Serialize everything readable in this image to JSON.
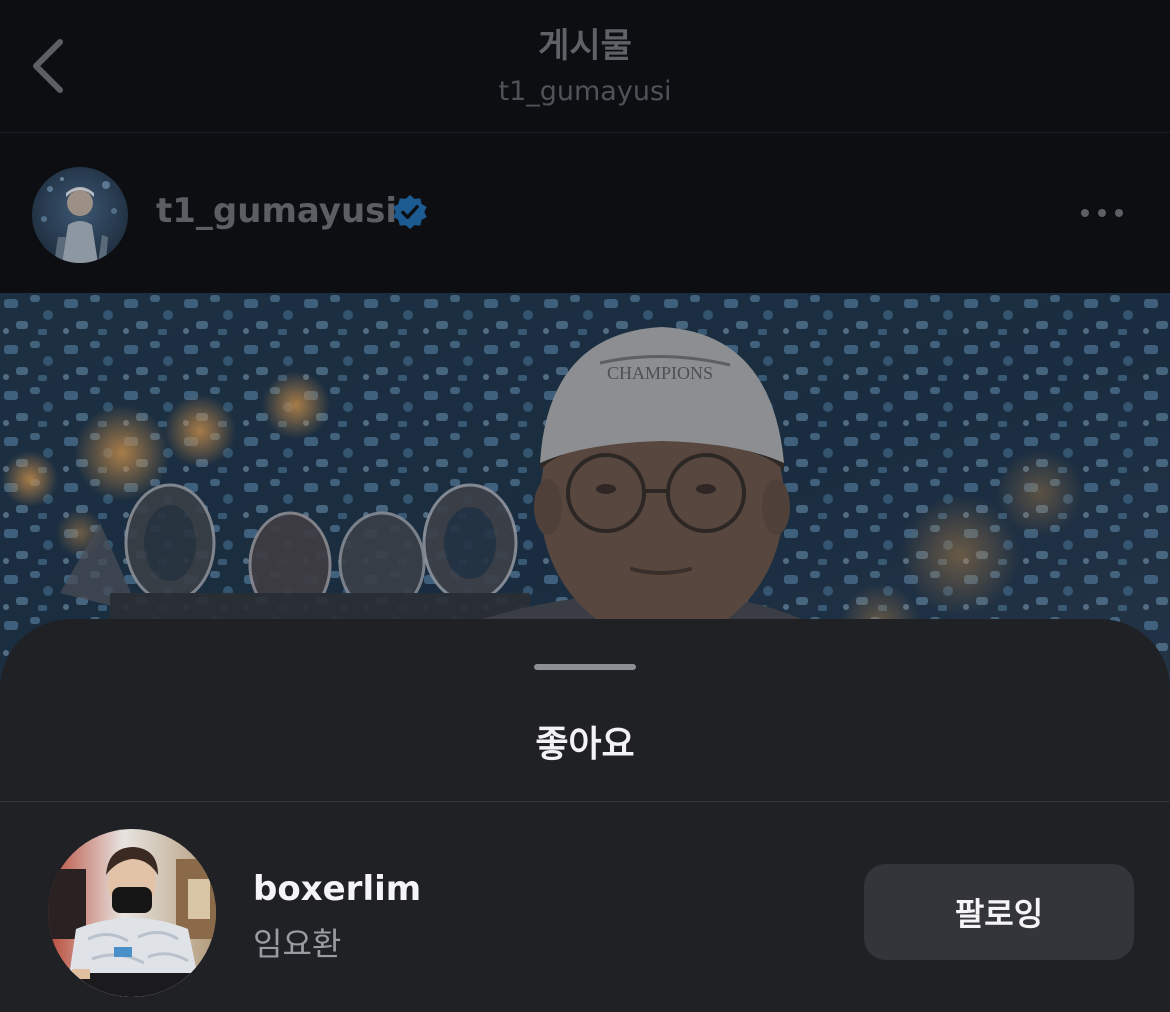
{
  "nav": {
    "title": "게시물",
    "subtitle": "t1_gumayusi"
  },
  "post": {
    "username": "t1_gumayusi",
    "verified": true,
    "cap_text": "CHAMPIONS"
  },
  "likes_sheet": {
    "title": "좋아요",
    "items": [
      {
        "username": "boxerlim",
        "full_name": "임요환",
        "button_label": "팔로잉"
      }
    ]
  },
  "colors": {
    "nav_background": "#0c0e12",
    "sheet_background": "#202125",
    "follow_button": "#33353b",
    "verified_badge": "#1c5b92",
    "primary_text": "#f5f5f7",
    "secondary_text": "#9a9ca1"
  },
  "icons": {
    "back": "chevron-left-icon",
    "verified": "verified-badge-icon",
    "more": "more-horizontal-icon"
  }
}
